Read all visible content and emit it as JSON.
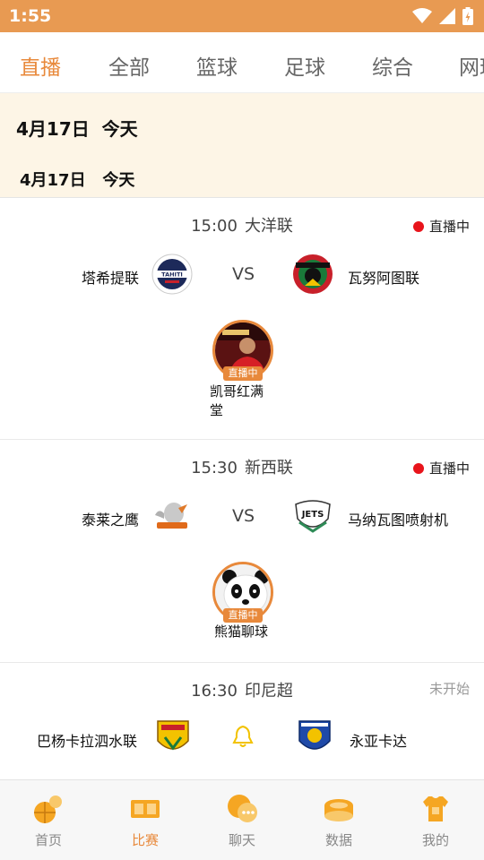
{
  "status_bar": {
    "time": "1:55"
  },
  "tabs": [
    {
      "label": "直播",
      "active": true
    },
    {
      "label": "全部",
      "active": false
    },
    {
      "label": "篮球",
      "active": false
    },
    {
      "label": "足球",
      "active": false
    },
    {
      "label": "综合",
      "active": false
    },
    {
      "label": "网球",
      "active": false
    }
  ],
  "date_header": {
    "big": "4月17日  今天",
    "small": "4月17日   今天"
  },
  "matches": [
    {
      "time": "15:00",
      "league": "大洋联",
      "status": "直播中",
      "live": true,
      "home": "塔希提联",
      "vs": "VS",
      "away": "瓦努阿图联",
      "home_logo_text": "TAHITI",
      "anchor": {
        "name": "凯哥红满\n堂",
        "badge": "直播中"
      }
    },
    {
      "time": "15:30",
      "league": "新西联",
      "status": "直播中",
      "live": true,
      "home": "泰莱之鹰",
      "vs": "VS",
      "away": "马纳瓦图喷射机",
      "away_logo_text": "JETS",
      "anchor": {
        "name": "熊猫聊球",
        "badge": "直播中"
      }
    },
    {
      "time": "16:30",
      "league": "印尼超",
      "status": "未开始",
      "live": false,
      "home": "巴杨卡拉泗水联",
      "away": "永亚卡达"
    }
  ],
  "bottom_nav": [
    {
      "label": "首页",
      "icon": "basketball-football-icon",
      "active": false
    },
    {
      "label": "比赛",
      "icon": "scoreboard-icon",
      "active": true
    },
    {
      "label": "聊天",
      "icon": "chat-bubble-icon",
      "active": false
    },
    {
      "label": "数据",
      "icon": "stadium-icon",
      "active": false
    },
    {
      "label": "我的",
      "icon": "jersey-icon",
      "active": false
    }
  ],
  "colors": {
    "accent": "#e8893b",
    "status_bar": "#e89a52",
    "banner_bg": "#fdf5e6",
    "live_dot": "#e8141b"
  }
}
